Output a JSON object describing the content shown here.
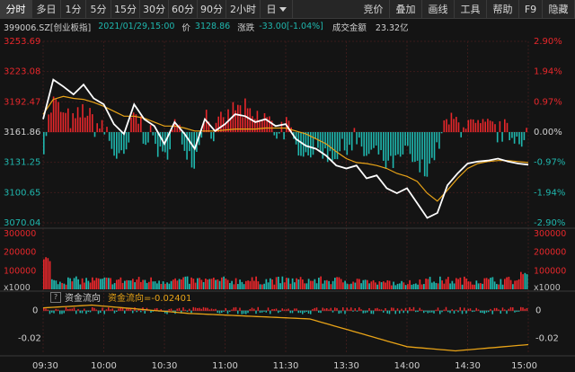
{
  "toolbar": {
    "left": [
      {
        "name": "tab-intraday",
        "label": "分时",
        "active": true,
        "w": 36
      },
      {
        "name": "tab-multiday",
        "label": "多日",
        "w": 32
      },
      {
        "name": "tab-1min",
        "label": "1分",
        "w": 28
      },
      {
        "name": "tab-5min",
        "label": "5分",
        "w": 28
      },
      {
        "name": "tab-15min",
        "label": "15分",
        "w": 32
      },
      {
        "name": "tab-30min",
        "label": "30分",
        "w": 32
      },
      {
        "name": "tab-60min",
        "label": "60分",
        "w": 32
      },
      {
        "name": "tab-90min",
        "label": "90分",
        "w": 32
      },
      {
        "name": "tab-2hour",
        "label": "2小时",
        "w": 38
      },
      {
        "name": "tab-day-dropdown",
        "label": "日",
        "w": 36,
        "caret": true
      }
    ],
    "right": [
      {
        "name": "tab-compare",
        "label": "竞价",
        "w": 36
      },
      {
        "name": "tab-overlay",
        "label": "叠加",
        "w": 36
      },
      {
        "name": "tab-draw",
        "label": "画线",
        "w": 36
      },
      {
        "name": "tab-tools",
        "label": "工具",
        "w": 36
      },
      {
        "name": "tab-help",
        "label": "帮助",
        "w": 36
      },
      {
        "name": "tab-f9",
        "label": "F9",
        "w": 26
      },
      {
        "name": "tab-hide",
        "label": "隐藏",
        "w": 36
      }
    ]
  },
  "info": {
    "code": "399006.SZ[创业板指]",
    "datetime": "2021/01/29,15:00",
    "price_label": "价",
    "price": "3128.86",
    "change_label": "涨跌",
    "change": "-33.00[-1.04%]",
    "turnover_label": "成交金额",
    "turnover": "23.32亿"
  },
  "colors": {
    "up": "#e8272b",
    "down": "#1fb7ae",
    "price": "#ffffff",
    "avg": "#e8a317",
    "grid": "#3a1b1b",
    "axis_text": "#bdbdbd",
    "pct_up": "#e8272b",
    "pct_down": "#1fb7ae",
    "pct_zero": "#cfcfcf",
    "highlight": "#e8a317"
  },
  "price_axis": {
    "labels": [
      "3253.69",
      "3223.08",
      "3192.47",
      "3161.86",
      "3131.25",
      "3100.65",
      "3070.04"
    ],
    "pct_labels": [
      "2.90%",
      "1.94%",
      "0.97%",
      "0.00%",
      "-0.97%",
      "-1.94%",
      "-2.90%"
    ],
    "max": 3253.69,
    "min": 3070.04,
    "pre_close": 3161.86
  },
  "volume_axis": {
    "labels": [
      "300000",
      "200000",
      "100000"
    ],
    "unit": "x1000",
    "max": 300000
  },
  "flow": {
    "help_icon": "?",
    "title": "资金流向",
    "value_text": "资金流向=-0.02401",
    "axis_labels": [
      "0",
      "-0.02"
    ],
    "min": -0.03,
    "max": 0.005
  },
  "time_axis": [
    "09:30",
    "10:00",
    "10:30",
    "11:00",
    "11:30",
    "13:30",
    "14:00",
    "14:30",
    "15:00"
  ],
  "chart_data": {
    "type": "line",
    "x": [
      "09:30",
      "09:35",
      "09:40",
      "09:45",
      "09:50",
      "09:55",
      "10:00",
      "10:05",
      "10:10",
      "10:15",
      "10:20",
      "10:25",
      "10:30",
      "10:35",
      "10:40",
      "10:45",
      "10:50",
      "10:55",
      "11:00",
      "11:05",
      "11:10",
      "11:15",
      "11:20",
      "11:25",
      "11:30",
      "13:05",
      "13:10",
      "13:15",
      "13:20",
      "13:25",
      "13:30",
      "13:35",
      "13:40",
      "13:45",
      "13:50",
      "13:55",
      "14:00",
      "14:05",
      "14:10",
      "14:15",
      "14:20",
      "14:25",
      "14:30",
      "14:35",
      "14:40",
      "14:45",
      "14:50",
      "14:55",
      "15:00"
    ],
    "series": [
      {
        "values": [
          3175,
          3215,
          3208,
          3200,
          3210,
          3196,
          3190,
          3170,
          3160,
          3190,
          3175,
          3168,
          3150,
          3172,
          3160,
          3145,
          3175,
          3163,
          3170,
          3180,
          3178,
          3172,
          3175,
          3168,
          3170,
          3155,
          3148,
          3145,
          3138,
          3128,
          3125,
          3128,
          3115,
          3118,
          3105,
          3100,
          3105,
          3090,
          3075,
          3080,
          3108,
          3120,
          3130,
          3132,
          3133,
          3135,
          3132,
          3130,
          3128.86
        ]
      },
      {
        "values": [
          3180,
          3195,
          3198,
          3196,
          3195,
          3192,
          3188,
          3183,
          3178,
          3178,
          3176,
          3172,
          3168,
          3168,
          3166,
          3163,
          3163,
          3163,
          3164,
          3165,
          3165,
          3165,
          3166,
          3166,
          3166,
          3163,
          3160,
          3155,
          3150,
          3142,
          3135,
          3131,
          3130,
          3128,
          3125,
          3120,
          3117,
          3112,
          3100,
          3092,
          3103,
          3115,
          3125,
          3130,
          3132,
          3133,
          3133,
          3132,
          3131
        ]
      }
    ],
    "ylim": [
      3070.04,
      3253.69
    ]
  }
}
